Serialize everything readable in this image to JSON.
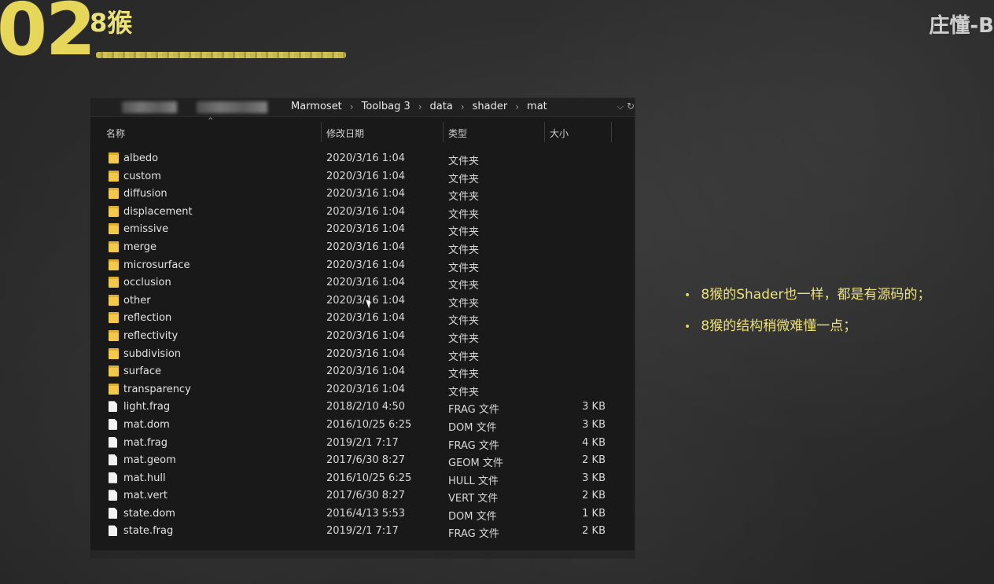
{
  "slide": {
    "number": "02",
    "title": "8猴",
    "author": "庄懂-B"
  },
  "explorer": {
    "breadcrumbs": [
      "Marmoset",
      "Toolbag 3",
      "data",
      "shader",
      "mat"
    ],
    "columns": {
      "name": "名称",
      "date": "修改日期",
      "type": "类型",
      "size": "大小"
    },
    "items": [
      {
        "name": "albedo",
        "date": "2020/3/16 1:04",
        "type": "文件夹",
        "size": "",
        "kind": "folder"
      },
      {
        "name": "custom",
        "date": "2020/3/16 1:04",
        "type": "文件夹",
        "size": "",
        "kind": "folder"
      },
      {
        "name": "diffusion",
        "date": "2020/3/16 1:04",
        "type": "文件夹",
        "size": "",
        "kind": "folder"
      },
      {
        "name": "displacement",
        "date": "2020/3/16 1:04",
        "type": "文件夹",
        "size": "",
        "kind": "folder"
      },
      {
        "name": "emissive",
        "date": "2020/3/16 1:04",
        "type": "文件夹",
        "size": "",
        "kind": "folder"
      },
      {
        "name": "merge",
        "date": "2020/3/16 1:04",
        "type": "文件夹",
        "size": "",
        "kind": "folder"
      },
      {
        "name": "microsurface",
        "date": "2020/3/16 1:04",
        "type": "文件夹",
        "size": "",
        "kind": "folder"
      },
      {
        "name": "occlusion",
        "date": "2020/3/16 1:04",
        "type": "文件夹",
        "size": "",
        "kind": "folder"
      },
      {
        "name": "other",
        "date": "2020/3/16 1:04",
        "type": "文件夹",
        "size": "",
        "kind": "folder"
      },
      {
        "name": "reflection",
        "date": "2020/3/16 1:04",
        "type": "文件夹",
        "size": "",
        "kind": "folder"
      },
      {
        "name": "reflectivity",
        "date": "2020/3/16 1:04",
        "type": "文件夹",
        "size": "",
        "kind": "folder"
      },
      {
        "name": "subdivision",
        "date": "2020/3/16 1:04",
        "type": "文件夹",
        "size": "",
        "kind": "folder"
      },
      {
        "name": "surface",
        "date": "2020/3/16 1:04",
        "type": "文件夹",
        "size": "",
        "kind": "folder"
      },
      {
        "name": "transparency",
        "date": "2020/3/16 1:04",
        "type": "文件夹",
        "size": "",
        "kind": "folder"
      },
      {
        "name": "light.frag",
        "date": "2018/2/10 4:50",
        "type": "FRAG 文件",
        "size": "3 KB",
        "kind": "file"
      },
      {
        "name": "mat.dom",
        "date": "2016/10/25 6:25",
        "type": "DOM 文件",
        "size": "3 KB",
        "kind": "file"
      },
      {
        "name": "mat.frag",
        "date": "2019/2/1 7:17",
        "type": "FRAG 文件",
        "size": "4 KB",
        "kind": "file"
      },
      {
        "name": "mat.geom",
        "date": "2017/6/30 8:27",
        "type": "GEOM 文件",
        "size": "2 KB",
        "kind": "file"
      },
      {
        "name": "mat.hull",
        "date": "2016/10/25 6:25",
        "type": "HULL 文件",
        "size": "3 KB",
        "kind": "file"
      },
      {
        "name": "mat.vert",
        "date": "2017/6/30 8:27",
        "type": "VERT 文件",
        "size": "2 KB",
        "kind": "file"
      },
      {
        "name": "state.dom",
        "date": "2016/4/13 5:53",
        "type": "DOM 文件",
        "size": "1 KB",
        "kind": "file"
      },
      {
        "name": "state.frag",
        "date": "2019/2/1 7:17",
        "type": "FRAG 文件",
        "size": "2 KB",
        "kind": "file"
      }
    ]
  },
  "bullets": [
    "8猴的Shader也一样，都是有源码的；",
    "8猴的结构稍微难懂一点；"
  ],
  "colors": {
    "accent_yellow": "#ece27a",
    "folder_yellow": "#f3c94c",
    "explorer_bg": "#191919"
  }
}
